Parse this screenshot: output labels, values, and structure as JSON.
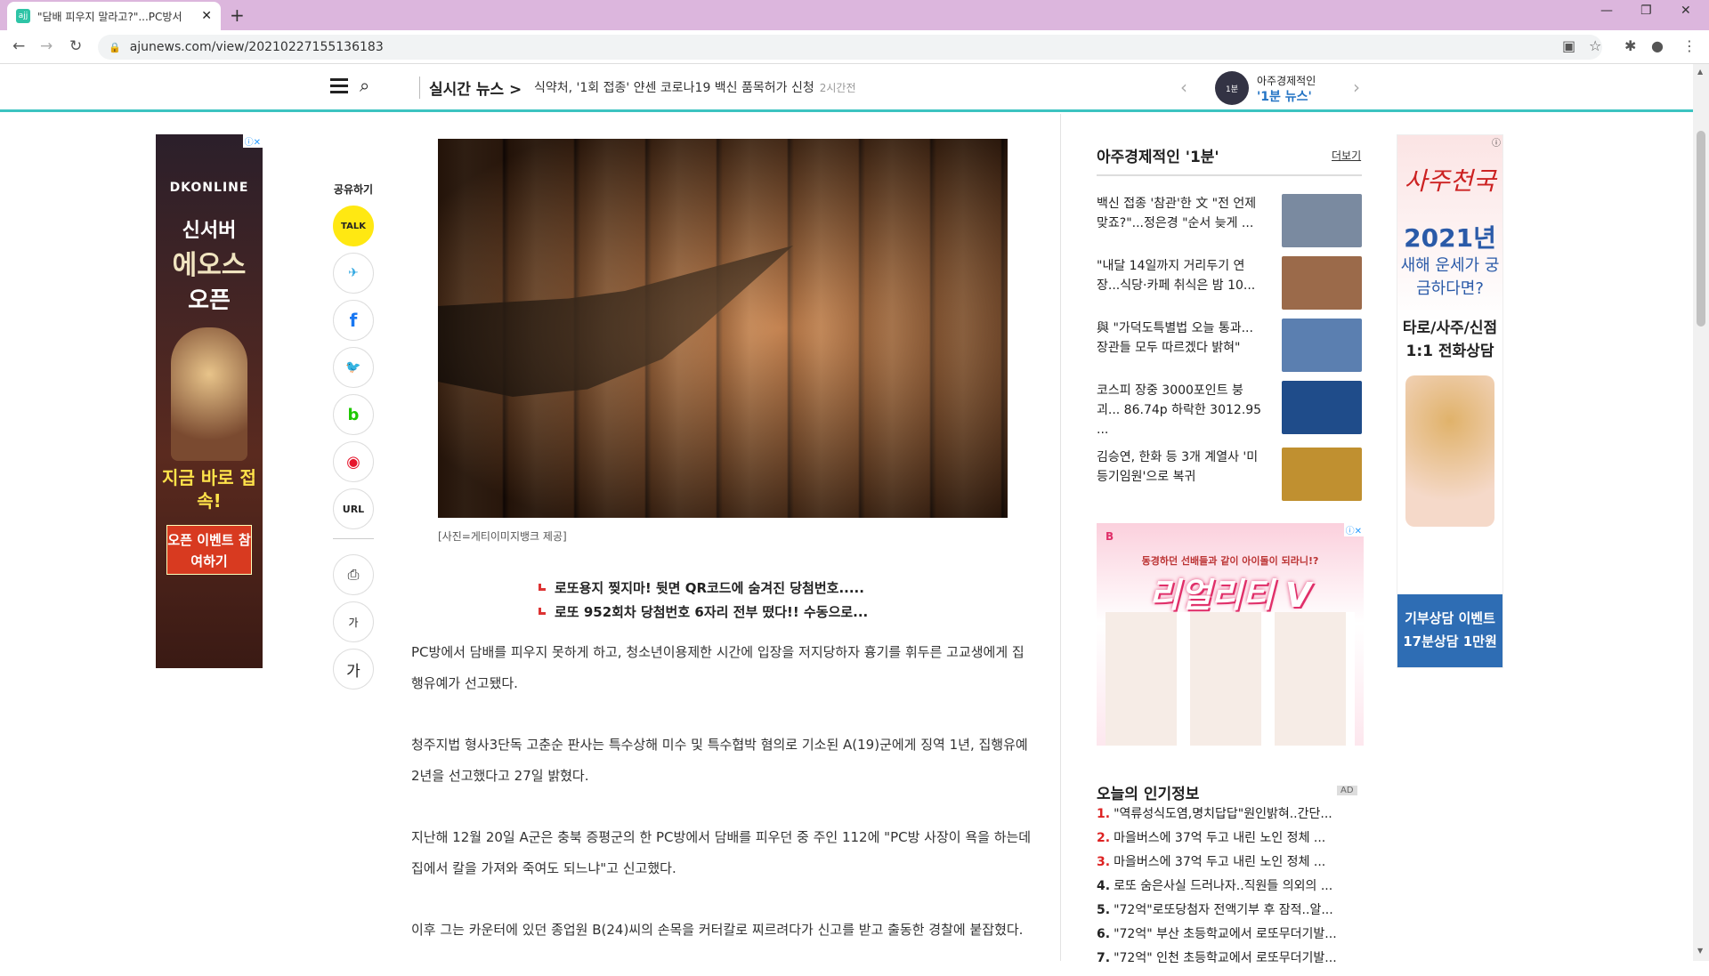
{
  "browser": {
    "tab_title": "\"담배 피우지 말라고?\"...PC방서",
    "url": "ajunews.com/view/20210227155136183"
  },
  "header": {
    "realtime_label": "실시간 뉴스 >",
    "realtime_headline": "식약처, '1회 접종' 얀센 코로나19 백신 품목허가 신청",
    "realtime_time": "2시간전",
    "onemin_top": "아주경제적인",
    "onemin_bottom": "'1분 뉴스'"
  },
  "left_ad": {
    "logo": "DKONLINE",
    "line1": "신서버",
    "line2": "에오스",
    "line3": "오픈",
    "line4": "지금 바로 접속!",
    "button": "오픈 이벤트 참여하기"
  },
  "share": {
    "label": "공유하기",
    "talk": "TALK",
    "telegram": "✈",
    "facebook": "f",
    "twitter": "🐦",
    "band": "b",
    "weibo": "◉",
    "url": "URL",
    "print": "⎙",
    "font_small": "가",
    "font_large": "가"
  },
  "article": {
    "caption": "[사진=게티이미지뱅크 제공]",
    "related": [
      "로또용지 찢지마! 뒷면 QR코드에 숨겨진 당첨번호.....",
      "로또 952회차 당첨번호 6자리 전부 떴다!! 수동으로..."
    ],
    "paragraphs": [
      "PC방에서 담배를 피우지 못하게 하고, 청소년이용제한 시간에 입장을 저지당하자 흉기를 휘두른 고교생에게 집행유예가 선고됐다.",
      "청주지법 형사3단독 고춘순 판사는 특수상해 미수 및 특수협박 혐의로 기소된 A(19)군에게 징역 1년, 집행유예 2년을 선고했다고 27일 밝혔다.",
      "지난해 12월 20일 A군은 충북 증평군의 한 PC방에서 담배를 피우던 중 주인 112에 \"PC방 사장이 욕을 하는데 집에서 칼을 가져와 죽여도 되느냐\"고 신고했다.",
      "이후 그는 카운터에 있던 종업원 B(24)씨의 손목을 커터칼로 찌르려다가 신고를 받고 출동한 경찰에 붙잡혔다."
    ]
  },
  "onemin": {
    "title": "아주경제적인 '1분'",
    "more": "더보기",
    "items": [
      {
        "text": "백신 접종 '참관'한 文 \"전 언제 맞죠?\"...정은경 \"순서 늦게 ...",
        "color": "#7a8aa0"
      },
      {
        "text": "\"내달 14일까지 거리두기 연장...식당·카페 취식은 밤 10...",
        "color": "#9b6a4a"
      },
      {
        "text": "與 \"가덕도특별법 오늘 통과... 장관들 모두 따르겠다 밝혀\"",
        "color": "#5b7fb0"
      },
      {
        "text": "코스피 장중 3000포인트 붕괴... 86.74p 하락한 3012.95 ...",
        "color": "#1f4c8a"
      },
      {
        "text": "김승연, 한화 등 3개 계열사 '미등기임원'으로 복귀",
        "color": "#c09030"
      }
    ]
  },
  "mid_ad": {
    "logo": "B",
    "sub": "동경하던 선배들과 같이 아이돌이 되라니!?",
    "title": "리얼리티 V"
  },
  "right_ad": {
    "h1": "사주천국",
    "h2": "2021년",
    "h3": "새해 운세가 궁금하다면?",
    "h4": "타로/사주/신점 1:1 전화상담",
    "bottom": "기부상담 이벤트 17분상담 1만원"
  },
  "popular": {
    "title": "오늘의 인기정보",
    "ad": "AD",
    "items": [
      {
        "num": "1.",
        "text": "\"역류성식도염,명치답답\"원인밝혀..간단...",
        "red": true
      },
      {
        "num": "2.",
        "text": "마을버스에 37억 두고 내린 노인 정체 ...",
        "red": true
      },
      {
        "num": "3.",
        "text": "마을버스에 37억 두고 내린 노인 정체 ...",
        "red": true
      },
      {
        "num": "4.",
        "text": "로또 숨은사실 드러나자..직원들 의외의 ...",
        "red": false
      },
      {
        "num": "5.",
        "text": "\"72억\"로또당첨자 전액기부 후 잠적..알...",
        "red": false
      },
      {
        "num": "6.",
        "text": "\"72억\" 부산 초등학교에서 로또무더기발...",
        "red": false
      },
      {
        "num": "7.",
        "text": "\"72억\" 인천 초등학교에서 로또무더기발...",
        "red": false
      }
    ]
  }
}
